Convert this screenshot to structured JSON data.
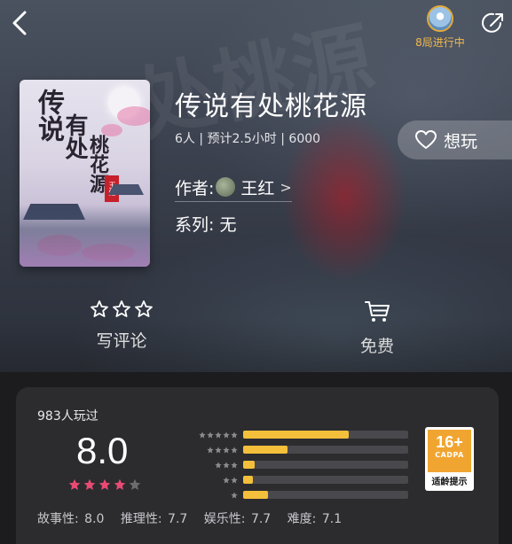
{
  "header": {
    "status_text": "8局进行中",
    "back_icon": "chevron-left-icon",
    "share_icon": "share-icon"
  },
  "game": {
    "title": "传说有处桃花源",
    "meta": "6人 | 预计2.5小时 | 6000",
    "author_label": "作者:",
    "author_name": "王红",
    "author_chevron": ">",
    "series_label": "系列:",
    "series_value": "无",
    "cover": {
      "calligraphy_1": "传说",
      "calligraphy_2": "有处",
      "calligraphy_3": "桃花源",
      "seal_text": "王红"
    },
    "background_text": "处桃源"
  },
  "actions": {
    "want_label": "想玩",
    "review_label": "写评论",
    "price_label": "免费"
  },
  "rating": {
    "played_count": "983人玩过",
    "score": "8.0",
    "score_stars": 4,
    "distribution": [
      {
        "stars": 5,
        "fraction": 0.64
      },
      {
        "stars": 4,
        "fraction": 0.27
      },
      {
        "stars": 3,
        "fraction": 0.07
      },
      {
        "stars": 2,
        "fraction": 0.06
      },
      {
        "stars": 1,
        "fraction": 0.15
      }
    ],
    "sub_scores": {
      "story": "故事性: 8.0",
      "reasoning": "推理性: 7.7",
      "entertainment": "娱乐性: 7.7",
      "difficulty": "难度: 7.1"
    }
  },
  "age_badge": {
    "age": "16+",
    "org": "CADPA",
    "tip": "适龄提示"
  },
  "colors": {
    "accent_gold": "#f4bf3a",
    "status_gold": "#f3b94a",
    "star_pink": "#e84a74",
    "panel_bg": "#2c2c2f"
  }
}
